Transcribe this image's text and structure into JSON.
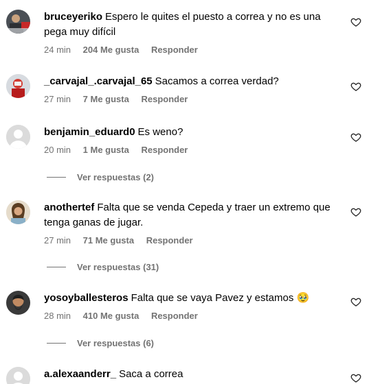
{
  "comments": [
    {
      "username": "bruceyeriko",
      "text": "Espero le quites el puesto a correa y no es una pega muy difícil",
      "time": "24 min",
      "likes": "204 Me gusta",
      "reply": "Responder",
      "avatar": "photo"
    },
    {
      "username": "_carvajal_.carvajal_65",
      "text": "Sacamos a correa verdad?",
      "time": "27 min",
      "likes": "7 Me gusta",
      "reply": "Responder",
      "avatar": "photo"
    },
    {
      "username": "benjamin_eduard0",
      "text": "Es weno?",
      "time": "20 min",
      "likes": "1 Me gusta",
      "reply": "Responder",
      "avatar": "default",
      "view_replies": "Ver respuestas (2)"
    },
    {
      "username": "anothertef",
      "text": "Falta que se venda Cepeda y traer un extremo que tenga ganas de jugar.",
      "time": "27 min",
      "likes": "71 Me gusta",
      "reply": "Responder",
      "avatar": "photo",
      "view_replies": "Ver respuestas (31)"
    },
    {
      "username": "yosoyballesteros",
      "text": "Falta que se vaya Pavez y estamos 🥹",
      "time": "28 min",
      "likes": "410 Me gusta",
      "reply": "Responder",
      "avatar": "photo",
      "view_replies": "Ver respuestas (6)"
    },
    {
      "username": "a.alexaanderr_",
      "text": "Saca a correa",
      "avatar": "default"
    }
  ],
  "colors": {
    "secondary_text": "#737373",
    "default_avatar_bg": "#dbdbdb"
  },
  "icons": {
    "like": "heart-outline-icon",
    "default_avatar": "user-silhouette-icon"
  }
}
